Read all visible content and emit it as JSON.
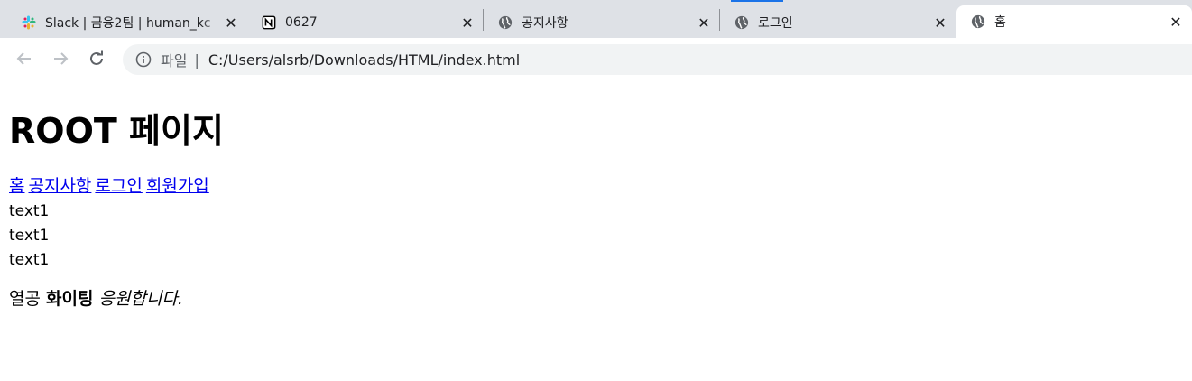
{
  "browser": {
    "tabs": [
      {
        "title": "Slack | 금융2팀 | human_kc",
        "icon": "slack-icon",
        "active": false
      },
      {
        "title": "0627",
        "icon": "notion-icon",
        "active": false
      },
      {
        "title": "공지사항",
        "icon": "globe-icon",
        "active": false
      },
      {
        "title": "로그인",
        "icon": "globe-icon",
        "active": false
      },
      {
        "title": "홈",
        "icon": "globe-icon",
        "active": true
      }
    ],
    "close_glyph": "✕",
    "address": {
      "scheme_label": "파일",
      "separator": "|",
      "url": "C:/Users/alsrb/Downloads/HTML/index.html"
    }
  },
  "page": {
    "heading": "ROOT 페이지",
    "nav_links": [
      "홈",
      "공지사항",
      "로그인",
      "회원가입"
    ],
    "text_lines": [
      "text1",
      "text1",
      "text1"
    ],
    "cheer": {
      "plain": "열공",
      "bold": "화이팅",
      "italic": "응원합니다."
    }
  },
  "colors": {
    "tabstrip_bg": "#dee1e6",
    "link": "#0000ee",
    "omnibox_bg": "#f1f3f4",
    "tab_indicator": "#1a73e8"
  }
}
